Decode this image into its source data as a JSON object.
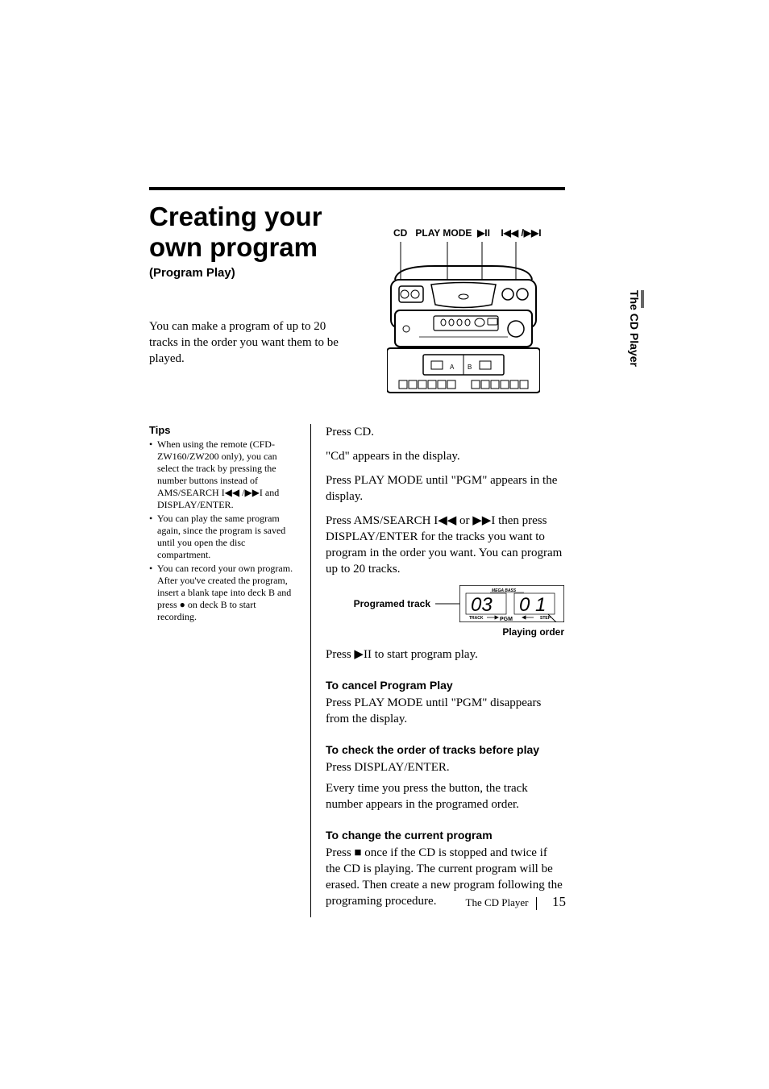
{
  "title_line1": "Creating your",
  "title_line2": "own program",
  "subtitle": "(Program Play)",
  "intro": "You can make a program of up to 20 tracks in the order you want them to be played.",
  "device_labels": {
    "cd": "CD",
    "play_mode": "PLAY MODE",
    "play_pause": "▶II",
    "prev_next": "I◀◀ /▶▶I"
  },
  "side_tab": "The CD Player",
  "tips": {
    "heading": "Tips",
    "items": [
      "When using the remote (CFD-ZW160/ZW200 only), you can select the track by pressing the number buttons instead of AMS/SEARCH I◀◀ /▶▶I and DISPLAY/ENTER.",
      "You can play the same program again, since the program is saved until you open the disc compartment.",
      "You can record your own program. After you've created the program, insert a blank tape into deck B and press ● on deck B to start recording."
    ]
  },
  "steps": {
    "s1a": "Press CD.",
    "s1b": "\"Cd\" appears in the display.",
    "s2": "Press PLAY MODE until \"PGM\" appears in the display.",
    "s3": "Press AMS/SEARCH I◀◀ or ▶▶I then press DISPLAY/ENTER for the tracks you want to program in the order you want. You can program up to 20 tracks.",
    "s4": "Press ▶II to start program play."
  },
  "display": {
    "programed_track_label": "Programed track",
    "playing_order_label": "Playing order",
    "mega_bass": "MEGA BASS",
    "track_word": "TRACK",
    "step_word": "STEP",
    "pgm": "PGM",
    "value_left": "03",
    "value_right": "01"
  },
  "cancel": {
    "heading": "To cancel Program Play",
    "body": "Press PLAY MODE until \"PGM\" disappears from the display."
  },
  "check": {
    "heading": "To check the order of tracks before play",
    "body1": "Press DISPLAY/ENTER.",
    "body2": "Every time you press the button, the track number appears in the programed order."
  },
  "change": {
    "heading": "To change the current program",
    "body": "Press ■ once if the CD is stopped and twice if the CD is playing. The current program will be erased. Then create a new program following the programing procedure."
  },
  "footer": {
    "section": "The CD Player",
    "page": "15"
  }
}
